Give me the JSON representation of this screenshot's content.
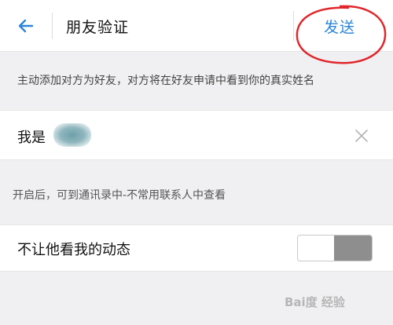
{
  "header": {
    "back_icon": "arrow-left-icon",
    "title": "朋友验证",
    "send_label": "发送",
    "accent_color": "#2a86d8",
    "annotation_color": "#e0262b"
  },
  "hint_top": "主动添加对方为好友，对方将在好友申请中看到你的真实姓名",
  "name_field": {
    "value": "我是",
    "clear_icon": "close-icon"
  },
  "hint_bottom": "开启后，可到通讯录中-不常用联系人中查看",
  "privacy": {
    "label": "不让他看我的动态",
    "toggle_on": false
  },
  "watermark": "Bai度 经验"
}
